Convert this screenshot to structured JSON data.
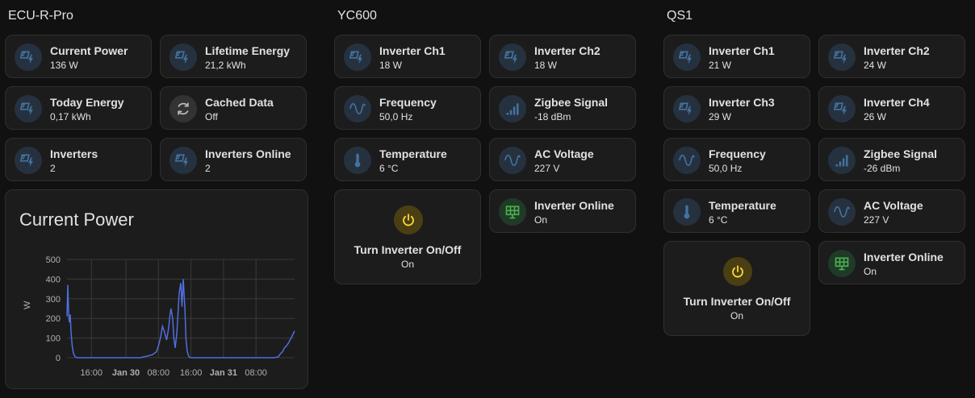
{
  "colors": {
    "background": "#111111",
    "card": "#1c1c1c",
    "icon_blue": "#44739e",
    "icon_bg_blue": "#263140",
    "power_yellow": "#fdd835",
    "online_green": "#4caf50",
    "chart_line": "#4f6fe0"
  },
  "columns": [
    {
      "title": "ECU-R-Pro",
      "tiles": [
        {
          "name": "Current Power",
          "value": "136 W",
          "icon": "solar-power-icon"
        },
        {
          "name": "Lifetime Energy",
          "value": "21,2 kWh",
          "icon": "solar-power-icon"
        },
        {
          "name": "Today Energy",
          "value": "0,17 kWh",
          "icon": "solar-power-icon"
        },
        {
          "name": "Cached Data",
          "value": "Off",
          "icon": "sync-icon"
        },
        {
          "name": "Inverters",
          "value": "2",
          "icon": "solar-power-icon"
        },
        {
          "name": "Inverters Online",
          "value": "2",
          "icon": "solar-power-icon"
        }
      ]
    },
    {
      "title": "YC600",
      "tiles": [
        {
          "name": "Inverter Ch1",
          "value": "18 W",
          "icon": "solar-power-icon"
        },
        {
          "name": "Inverter Ch2",
          "value": "18 W",
          "icon": "solar-power-icon"
        },
        {
          "name": "Frequency",
          "value": "50,0 Hz",
          "icon": "sine-wave-icon"
        },
        {
          "name": "Zigbee Signal",
          "value": "-18 dBm",
          "icon": "signal-bars-icon"
        },
        {
          "name": "Temperature",
          "value": "6 °C",
          "icon": "thermometer-icon"
        },
        {
          "name": "AC Voltage",
          "value": "227 V",
          "icon": "sine-wave-icon"
        },
        {
          "name": "Inverter Online",
          "value": "On",
          "icon": "solar-panel-icon"
        }
      ],
      "button": {
        "name": "Turn Inverter On/Off",
        "state": "On",
        "icon": "power-icon"
      }
    },
    {
      "title": "QS1",
      "tiles": [
        {
          "name": "Inverter Ch1",
          "value": "21 W",
          "icon": "solar-power-icon"
        },
        {
          "name": "Inverter Ch2",
          "value": "24 W",
          "icon": "solar-power-icon"
        },
        {
          "name": "Inverter Ch3",
          "value": "29 W",
          "icon": "solar-power-icon"
        },
        {
          "name": "Inverter Ch4",
          "value": "26 W",
          "icon": "solar-power-icon"
        },
        {
          "name": "Frequency",
          "value": "50,0 Hz",
          "icon": "sine-wave-icon"
        },
        {
          "name": "Zigbee Signal",
          "value": "-26 dBm",
          "icon": "signal-bars-icon"
        },
        {
          "name": "Temperature",
          "value": "6 °C",
          "icon": "thermometer-icon"
        },
        {
          "name": "AC Voltage",
          "value": "227 V",
          "icon": "sine-wave-icon"
        },
        {
          "name": "Inverter Online",
          "value": "On",
          "icon": "solar-panel-icon"
        }
      ],
      "button": {
        "name": "Turn Inverter On/Off",
        "state": "On",
        "icon": "power-icon"
      }
    }
  ],
  "chart_data": {
    "type": "line",
    "title": "Current Power",
    "ylabel": "W",
    "ylim": [
      0,
      500
    ],
    "yticks": [
      "0",
      "100",
      "200",
      "300",
      "400",
      "500"
    ],
    "xticks": [
      "16:00",
      "Jan 30",
      "08:00",
      "16:00",
      "Jan 31",
      "08:00"
    ],
    "grid": true,
    "series": [
      {
        "x": [
          0.0,
          0.2,
          0.4,
          0.6,
          0.8,
          1.0,
          1.3,
          1.6,
          2.0,
          2.5,
          3.0,
          4,
          6,
          8,
          10,
          12,
          14,
          16,
          18,
          19,
          20,
          21,
          22,
          22.5,
          23,
          23.5,
          24,
          24.5,
          25,
          25.3,
          25.6,
          26,
          26.3,
          26.6,
          27,
          27.3,
          27.6,
          28,
          28.3,
          28.6,
          29,
          29.3,
          29.6,
          30,
          30.5,
          31,
          31.5,
          32,
          32.5,
          33,
          34,
          36,
          38,
          40,
          42,
          44,
          46,
          48,
          50,
          51,
          52,
          52.5,
          53,
          53.5,
          54,
          54.5,
          55,
          55.5,
          56
        ],
        "y": [
          210,
          370,
          230,
          180,
          220,
          130,
          60,
          20,
          5,
          0,
          0,
          0,
          0,
          0,
          0,
          0,
          0,
          0,
          0,
          5,
          10,
          15,
          30,
          60,
          100,
          160,
          130,
          90,
          150,
          210,
          250,
          200,
          100,
          50,
          120,
          220,
          330,
          380,
          260,
          400,
          260,
          90,
          30,
          5,
          0,
          0,
          0,
          0,
          0,
          0,
          0,
          0,
          0,
          0,
          0,
          0,
          0,
          0,
          0,
          0,
          5,
          20,
          30,
          50,
          60,
          75,
          95,
          115,
          136
        ]
      }
    ]
  }
}
